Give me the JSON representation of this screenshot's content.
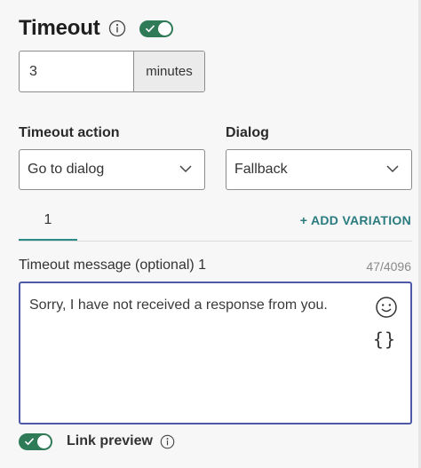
{
  "header": {
    "title": "Timeout",
    "toggle_on": true
  },
  "timeout": {
    "value": "3",
    "unit": "minutes"
  },
  "timeout_action": {
    "label": "Timeout action",
    "selected": "Go to dialog"
  },
  "dialog": {
    "label": "Dialog",
    "selected": "Fallback"
  },
  "tabs": [
    {
      "label": "1"
    }
  ],
  "add_variation_label": "+ ADD VARIATION",
  "message": {
    "label": "Timeout message (optional) 1",
    "count": "47/4096",
    "text": "Sorry, I have not received a response from you."
  },
  "link_preview": {
    "label": "Link preview",
    "toggle_on": true
  },
  "colors": {
    "toggle": "#2f7a57",
    "accent": "#2a8c86",
    "focus_border": "#4e5aa8"
  },
  "icons": [
    "info-icon",
    "check-icon",
    "chevron-down-icon",
    "emoji-icon",
    "variable-icon"
  ]
}
